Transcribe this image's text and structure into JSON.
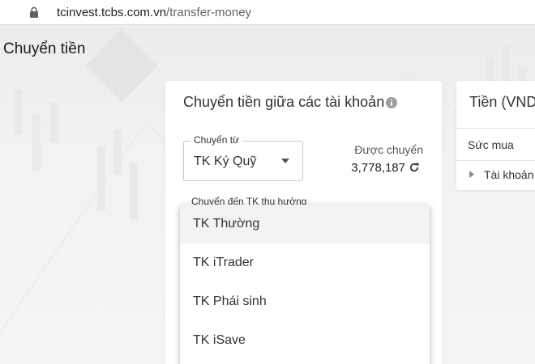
{
  "browser": {
    "url_host": "tcinvest.tcbs.com.vn",
    "url_path": "/transfer-money"
  },
  "page": {
    "title": "Chuyển tiền"
  },
  "transfer_card": {
    "title": "Chuyển tiền giữa các tài khoản",
    "from_label": "Chuyển từ",
    "from_value": "TK Ký Quỹ",
    "available_label": "Được chuyển",
    "available_value": "3,778,187",
    "to_label": "Chuyển đến TK thụ hưởng"
  },
  "dropdown": {
    "items": [
      {
        "label": "TK Thường"
      },
      {
        "label": "TK iTrader"
      },
      {
        "label": "TK Phái sinh"
      },
      {
        "label": "TK iSave"
      }
    ]
  },
  "cash_card": {
    "title": "Tiền (VND",
    "purchasing_power_label": "Sức mua",
    "account_label": "Tài khoản"
  },
  "icons": {
    "lock": "lock-icon",
    "info": "info-icon",
    "dropdown": "caret-down-icon",
    "refresh": "refresh-icon",
    "expand": "triangle-right-icon"
  },
  "colors": {
    "background": "#f3f3f3",
    "card": "#ffffff",
    "text": "#333333",
    "menu_active": "#f2f2f2"
  }
}
